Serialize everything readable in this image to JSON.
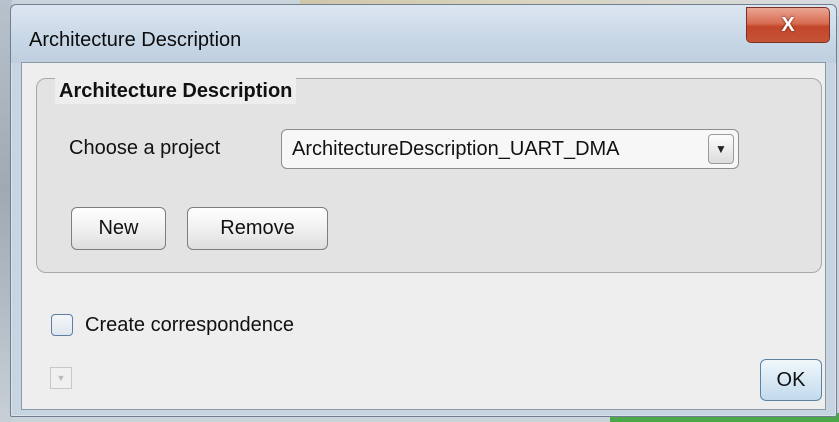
{
  "window": {
    "title": "Architecture Description",
    "close_glyph": "X"
  },
  "group": {
    "legend": "Architecture Description",
    "project_label": "Choose a project",
    "project_select": {
      "value": "ArchitectureDescription_UART_DMA",
      "arrow_icon": "caret-down-icon"
    },
    "new_button": "New",
    "remove_button": "Remove"
  },
  "checkbox": {
    "label": "Create correspondence",
    "checked": false
  },
  "footer": {
    "ok_button": "OK"
  },
  "colors": {
    "close_button": "#c94a2f",
    "ok_button_border": "#5b83a6",
    "client_background": "#eeeeee"
  }
}
